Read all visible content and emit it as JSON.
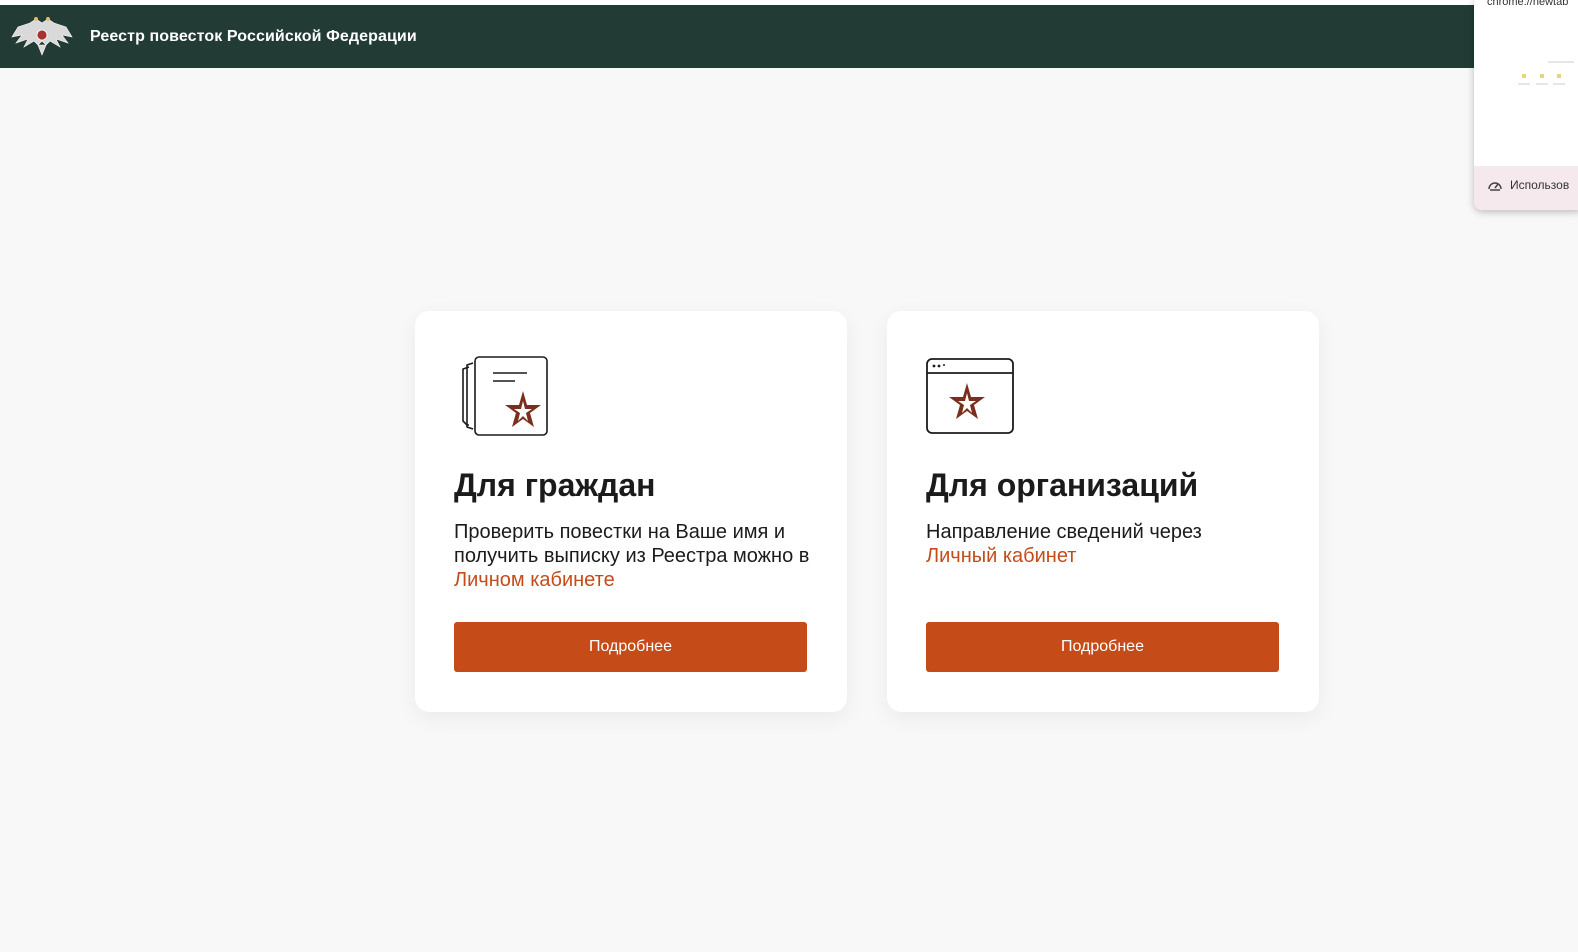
{
  "header": {
    "site_title": "Реестр повесток Российской Федерации"
  },
  "cards": [
    {
      "title": "Для граждан",
      "text_before": "Проверить повестки на Ваше имя и получить выписку из Реестра можно в ",
      "link": "Личном кабинете",
      "button": "Подробнее",
      "icon": "document-star-icon"
    },
    {
      "title": "Для организаций",
      "text_before": "Направление сведений через ",
      "link": "Личный кабинет",
      "button": "Подробнее",
      "icon": "browser-window-star-icon"
    }
  ],
  "tab_preview": {
    "url": "chrome://newtab",
    "footer_text": "Использов"
  },
  "colors": {
    "header_bg": "#223b35",
    "accent": "#c54c19",
    "page_bg": "#f8f8f8"
  }
}
